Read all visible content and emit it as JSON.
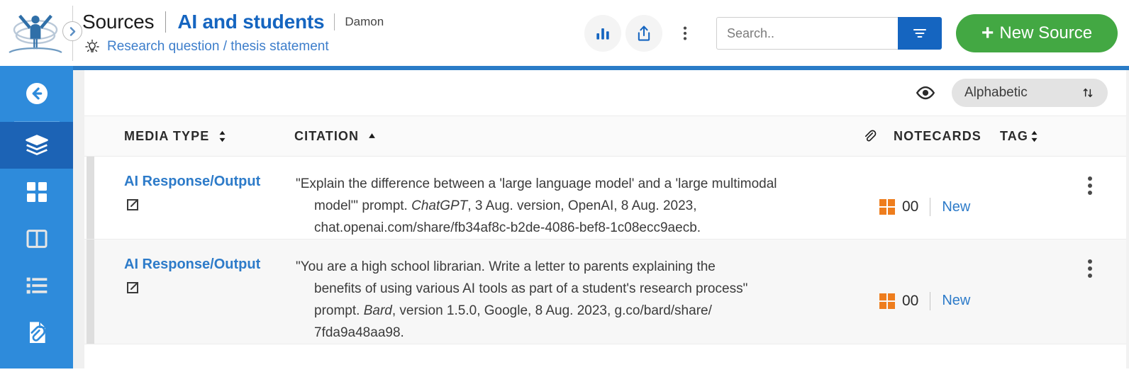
{
  "header": {
    "logo": "noodletools-logo",
    "expand_icon": "chevron-right-icon",
    "section_label": "Sources",
    "project_title": "AI and students",
    "user_name": "Damon",
    "subtitle_icon": "lightbulb-icon",
    "subtitle": "Research question / thesis statement",
    "toolbar": {
      "stats_icon": "bar-chart-icon",
      "share_icon": "share-upload-icon",
      "more_icon": "vertical-dots-icon",
      "search_value": "",
      "search_placeholder": "Search..",
      "filter_icon": "filter-icon",
      "new_source_label": "New Source",
      "new_source_plus": "+"
    }
  },
  "sidebar": {
    "items": [
      {
        "name": "back",
        "icon": "arrow-left-circle-icon",
        "active": false
      },
      {
        "name": "sources",
        "icon": "stacked-books-icon",
        "active": true
      },
      {
        "name": "dashboard",
        "icon": "grid-squares-icon",
        "active": false
      },
      {
        "name": "columns",
        "icon": "two-columns-icon",
        "active": false
      },
      {
        "name": "outline",
        "icon": "list-lines-icon",
        "active": false
      },
      {
        "name": "attachments",
        "icon": "document-paperclip-icon",
        "active": false
      }
    ]
  },
  "content_toolbar": {
    "visibility_icon": "eye-icon",
    "sort_label": "Alphabetic",
    "sort_icon": "sort-updown-arrows-icon"
  },
  "table": {
    "columns": {
      "media_type": "MEDIA TYPE",
      "citation": "CITATION",
      "attachment_icon": "paperclip-icon",
      "notecards": "NOTECARDS",
      "tag": "TAG"
    },
    "sort_state": {
      "media_type": "unsorted",
      "citation": "ascending",
      "tag": "unsorted"
    },
    "rows": [
      {
        "media_type": "AI Response/Output",
        "open_icon": "external-link-icon",
        "citation_lines": [
          {
            "indent": false,
            "text": "\"Explain the difference between a 'large language model' and a 'large multimodal"
          },
          {
            "indent": true,
            "pre": "model\"' prompt. ",
            "italic": "ChatGPT",
            "post": ", 3 Aug. version, OpenAI, 8 Aug. 2023,"
          },
          {
            "indent": true,
            "text": "chat.openai.com/share/fb34af8c-b2de-4086-bef8-1c08ecc9aecb."
          }
        ],
        "notecard_icon": "notecard-grid-icon",
        "notecard_count": "00",
        "notecard_new": "New",
        "row_menu_icon": "vertical-dots-icon"
      },
      {
        "media_type": "AI Response/Output",
        "open_icon": "external-link-icon",
        "citation_lines": [
          {
            "indent": false,
            "text": "\"You are a high school librarian. Write a letter to parents explaining the"
          },
          {
            "indent": true,
            "text": "benefits of using various AI tools as part of a student's research process\""
          },
          {
            "indent": true,
            "pre": "prompt. ",
            "italic": "Bard",
            "post": ", version 1.5.0, Google, 8 Aug. 2023, g.co/bard/share/"
          },
          {
            "indent": true,
            "text": "7fda9a48aa98."
          }
        ],
        "notecard_icon": "notecard-grid-icon",
        "notecard_count": "00",
        "notecard_new": "New",
        "row_menu_icon": "vertical-dots-icon"
      }
    ]
  },
  "colors": {
    "brand_blue": "#1565c0",
    "sidebar_blue": "#2e8bdb",
    "sidebar_active": "#1c63b5",
    "rule_blue": "#2a7cc7",
    "link_blue": "#2d7bc9",
    "green": "#43a843",
    "notecard_orange": "#ee7d1d"
  }
}
